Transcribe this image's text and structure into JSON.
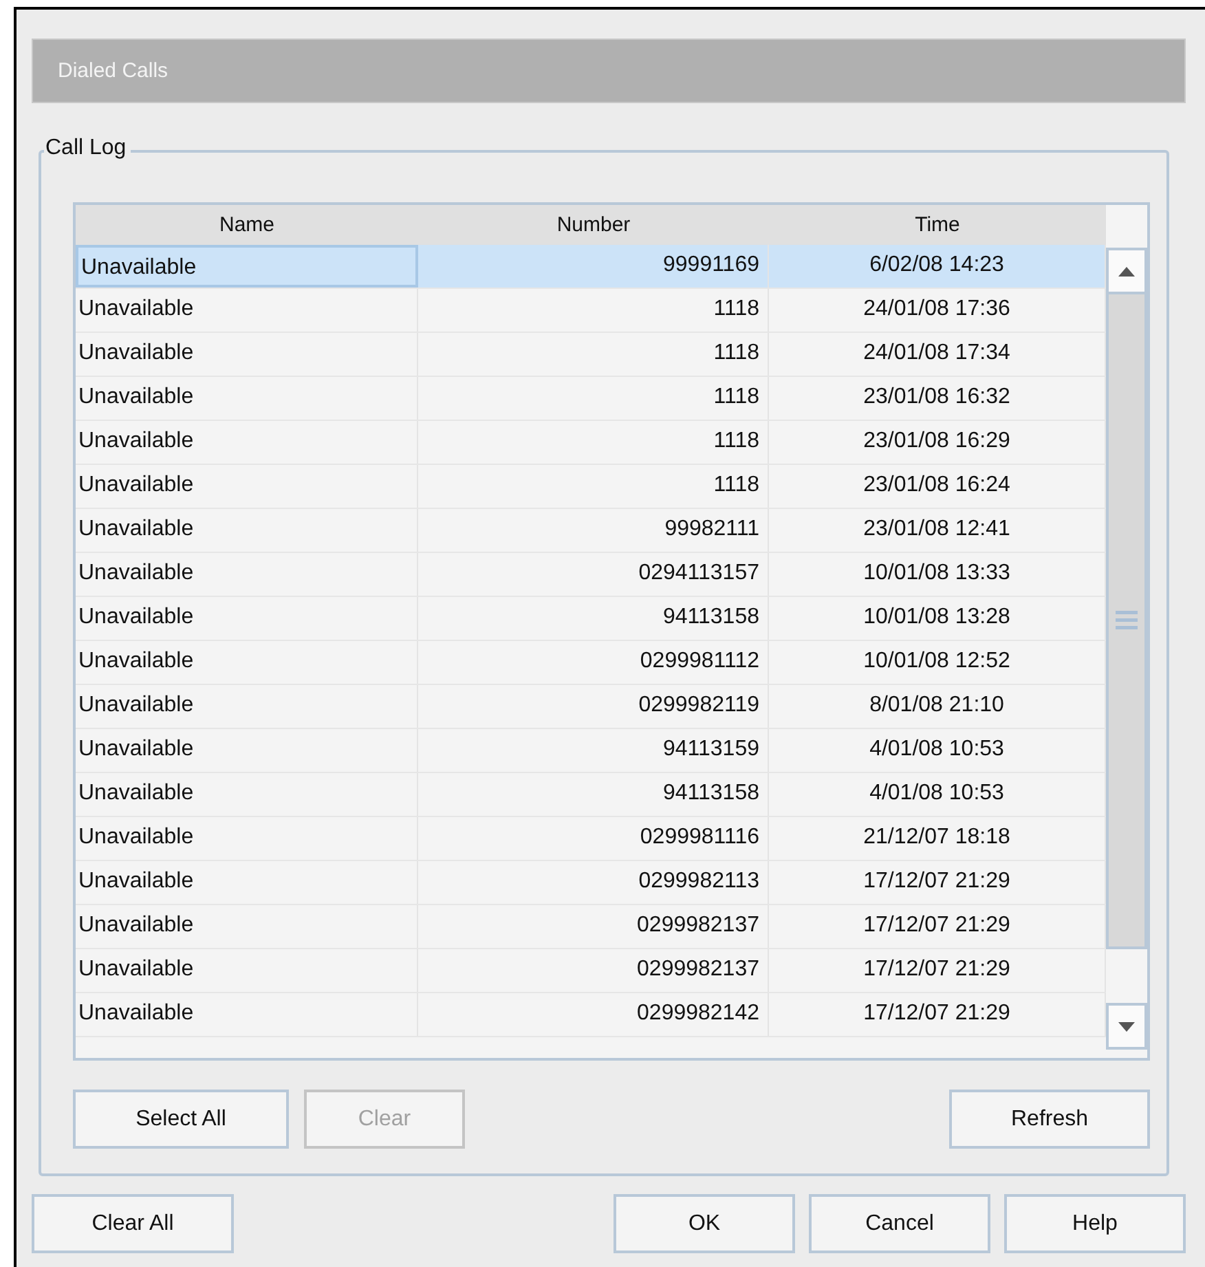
{
  "window": {
    "title": "Dialed Calls"
  },
  "call_log": {
    "label": "Call Log",
    "columns": [
      "Name",
      "Number",
      "Time"
    ],
    "rows": [
      {
        "name": "Unavailable",
        "number": "99991169",
        "time": "6/02/08 14:23",
        "selected": true
      },
      {
        "name": "Unavailable",
        "number": "1118",
        "time": "24/01/08 17:36",
        "selected": false
      },
      {
        "name": "Unavailable",
        "number": "1118",
        "time": "24/01/08 17:34",
        "selected": false
      },
      {
        "name": "Unavailable",
        "number": "1118",
        "time": "23/01/08 16:32",
        "selected": false
      },
      {
        "name": "Unavailable",
        "number": "1118",
        "time": "23/01/08 16:29",
        "selected": false
      },
      {
        "name": "Unavailable",
        "number": "1118",
        "time": "23/01/08 16:24",
        "selected": false
      },
      {
        "name": "Unavailable",
        "number": "99982111",
        "time": "23/01/08 12:41",
        "selected": false
      },
      {
        "name": "Unavailable",
        "number": "0294113157",
        "time": "10/01/08 13:33",
        "selected": false
      },
      {
        "name": "Unavailable",
        "number": "94113158",
        "time": "10/01/08 13:28",
        "selected": false
      },
      {
        "name": "Unavailable",
        "number": "0299981112",
        "time": "10/01/08 12:52",
        "selected": false
      },
      {
        "name": "Unavailable",
        "number": "0299982119",
        "time": "8/01/08 21:10",
        "selected": false
      },
      {
        "name": "Unavailable",
        "number": "94113159",
        "time": "4/01/08 10:53",
        "selected": false
      },
      {
        "name": "Unavailable",
        "number": "94113158",
        "time": "4/01/08 10:53",
        "selected": false
      },
      {
        "name": "Unavailable",
        "number": "0299981116",
        "time": "21/12/07 18:18",
        "selected": false
      },
      {
        "name": "Unavailable",
        "number": "0299982113",
        "time": "17/12/07 21:29",
        "selected": false
      },
      {
        "name": "Unavailable",
        "number": "0299982137",
        "time": "17/12/07 21:29",
        "selected": false
      },
      {
        "name": "Unavailable",
        "number": "0299982137",
        "time": "17/12/07 21:29",
        "selected": false
      },
      {
        "name": "Unavailable",
        "number": "0299982142",
        "time": "17/12/07 21:29",
        "selected": false
      }
    ],
    "buttons": [
      {
        "label": "Select All",
        "disabled": false
      },
      {
        "label": "Clear",
        "disabled": true
      }
    ],
    "refresh_button": {
      "label": "Refresh",
      "disabled": false
    }
  },
  "footer_buttons": {
    "left": [
      {
        "label": "Clear All",
        "disabled": false
      }
    ],
    "right": [
      {
        "label": "OK",
        "disabled": false
      },
      {
        "label": "Cancel",
        "disabled": false
      },
      {
        "label": "Help",
        "disabled": false
      }
    ]
  }
}
